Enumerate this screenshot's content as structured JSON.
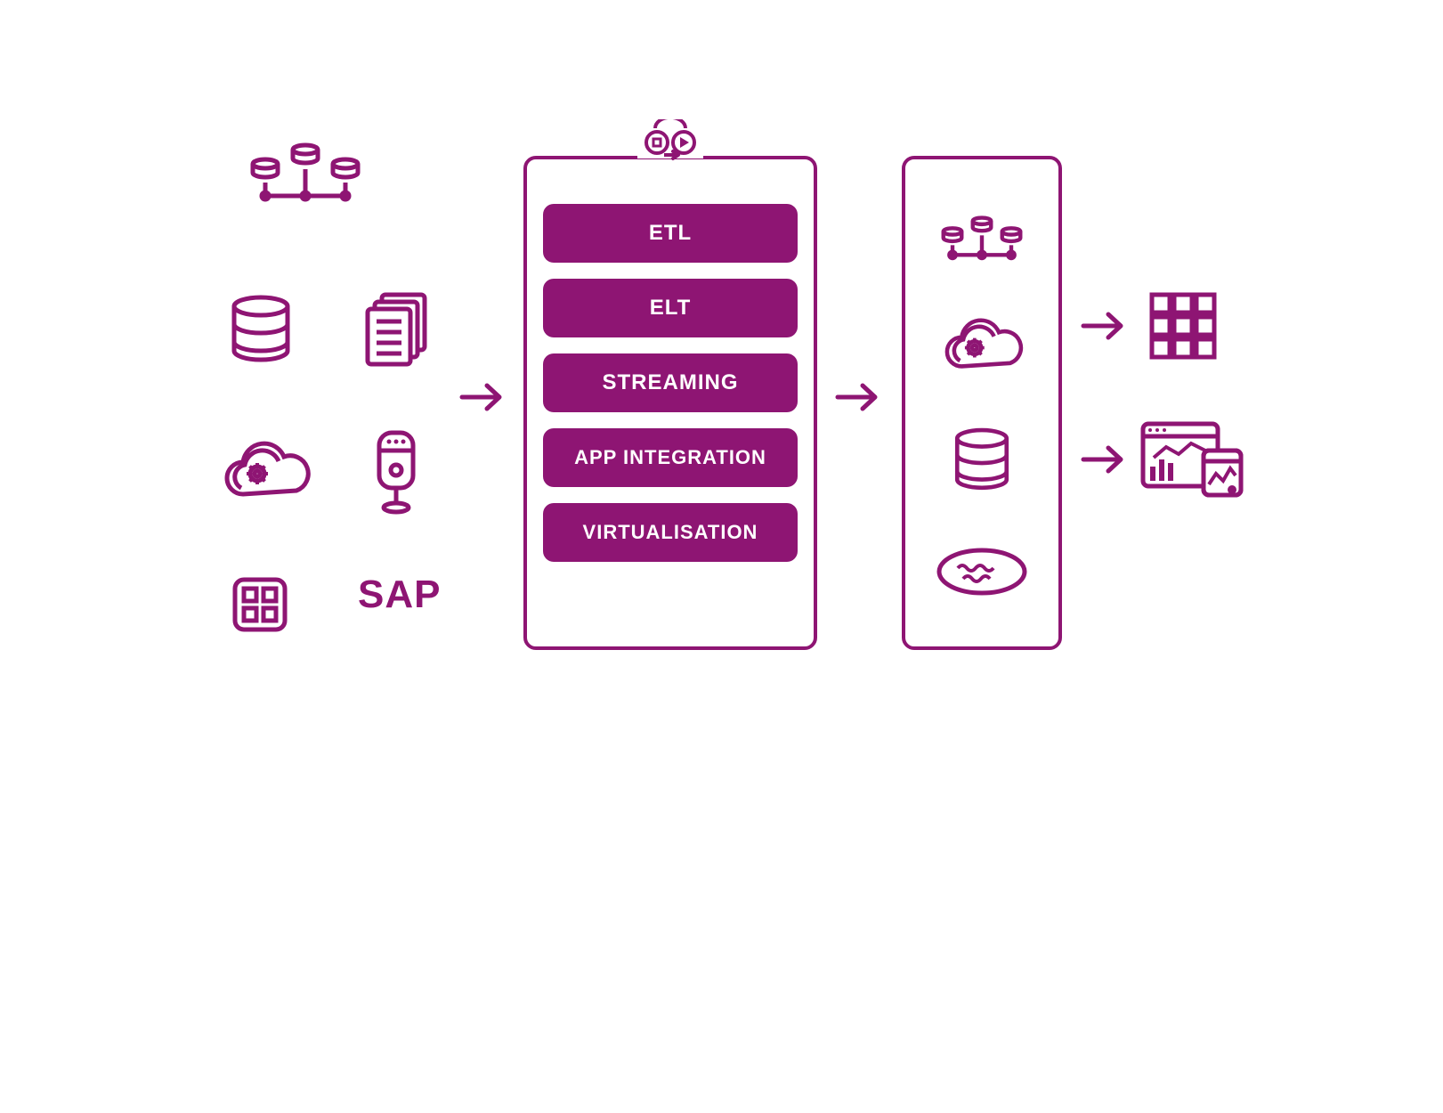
{
  "colors": {
    "accent": "#8e1573"
  },
  "sources": {
    "icons": [
      "cluster-database-icon",
      "database-icon",
      "files-icon",
      "cloud-gear-icon",
      "server-icon",
      "app-grid-icon"
    ],
    "sap_label": "SAP"
  },
  "center": {
    "pills": [
      "ETL",
      "ELT",
      "STREAMING",
      "APP INTEGRATION",
      "VIRTUALISATION"
    ],
    "top_icon": "data-exchange-icon"
  },
  "targets": {
    "icons": [
      "cluster-database-icon",
      "cloud-gear-icon",
      "database-icon",
      "data-lake-icon"
    ]
  },
  "outputs": {
    "icons": [
      "grid-apps-icon",
      "dashboard-chart-icon"
    ]
  },
  "arrows": {
    "count": 4,
    "glyph": "→"
  }
}
